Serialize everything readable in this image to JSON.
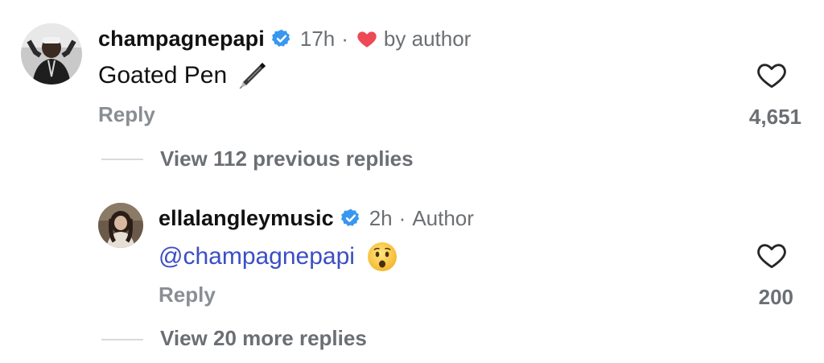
{
  "comment": {
    "username": "champagnepapi",
    "time": "17h",
    "liked_by_author_label": "by author",
    "text": "Goated Pen",
    "reply_label": "Reply",
    "likes": "4,651",
    "view_previous_label": "View 112 previous replies"
  },
  "reply": {
    "username": "ellalangleymusic",
    "time": "2h",
    "author_badge": "Author",
    "mention": "@champagnepapi",
    "reply_label": "Reply",
    "likes": "200",
    "view_more_label": "View 20 more replies"
  },
  "icons": {
    "verified": "verified-badge-icon",
    "heart_red": "heart-filled-icon",
    "heart_outline": "heart-outline-icon",
    "pen": "fountain-pen-emoji",
    "face": "frowning-face-emoji"
  },
  "colors": {
    "verified": "#3897f0",
    "heart": "#ed4956",
    "mention": "#3b4ec4",
    "muted": "#6b6f73"
  }
}
